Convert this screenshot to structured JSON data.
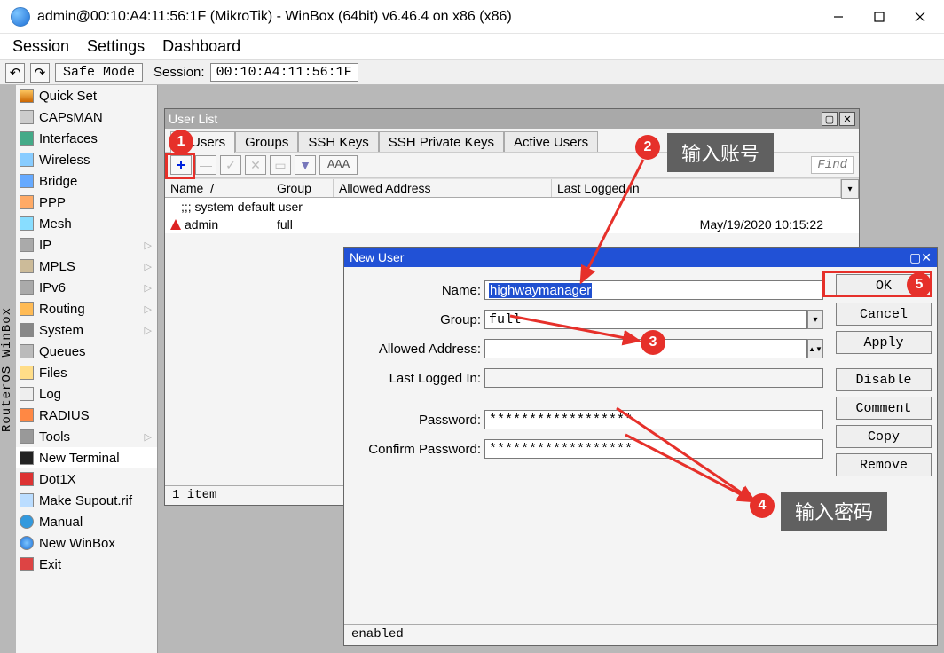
{
  "title": "admin@00:10:A4:11:56:1F (MikroTik) - WinBox (64bit) v6.46.4 on x86 (x86)",
  "menubar": {
    "items": [
      "Session",
      "Settings",
      "Dashboard"
    ]
  },
  "sessionbar": {
    "safe_mode": "Safe Mode",
    "session_label": "Session:",
    "session_value": "00:10:A4:11:56:1F"
  },
  "left_tab": "RouterOS WinBox",
  "side_menu": [
    {
      "label": "Quick Set",
      "icon": "quickset"
    },
    {
      "label": "CAPsMAN",
      "icon": "capsman"
    },
    {
      "label": "Interfaces",
      "icon": "interfaces"
    },
    {
      "label": "Wireless",
      "icon": "wireless"
    },
    {
      "label": "Bridge",
      "icon": "bridge"
    },
    {
      "label": "PPP",
      "icon": "ppp"
    },
    {
      "label": "Mesh",
      "icon": "mesh"
    },
    {
      "label": "IP",
      "icon": "ip",
      "sub": true
    },
    {
      "label": "MPLS",
      "icon": "mpls",
      "sub": true
    },
    {
      "label": "IPv6",
      "icon": "ipv6",
      "sub": true
    },
    {
      "label": "Routing",
      "icon": "routing",
      "sub": true
    },
    {
      "label": "System",
      "icon": "system",
      "sub": true
    },
    {
      "label": "Queues",
      "icon": "queues"
    },
    {
      "label": "Files",
      "icon": "files"
    },
    {
      "label": "Log",
      "icon": "log"
    },
    {
      "label": "RADIUS",
      "icon": "radius"
    },
    {
      "label": "Tools",
      "icon": "tools",
      "sub": true
    },
    {
      "label": "New Terminal",
      "icon": "terminal"
    },
    {
      "label": "Dot1X",
      "icon": "dot1x"
    },
    {
      "label": "Make Supout.rif",
      "icon": "supout"
    },
    {
      "label": "Manual",
      "icon": "manual"
    },
    {
      "label": "New WinBox",
      "icon": "winbox"
    },
    {
      "label": "Exit",
      "icon": "exit"
    }
  ],
  "user_list": {
    "title": "User List",
    "tabs": [
      "Users",
      "Groups",
      "SSH Keys",
      "SSH Private Keys",
      "Active Users"
    ],
    "aaa": "AAA",
    "find": "Find",
    "columns": [
      "Name",
      "Group",
      "Allowed Address",
      "Last Logged In"
    ],
    "group_row": ";;; system default user",
    "rows": [
      {
        "name": "admin",
        "group": "full",
        "allowed": "",
        "last": "May/19/2020 10:15:22"
      }
    ],
    "status": "1 item"
  },
  "new_user": {
    "title": "New User",
    "labels": {
      "name": "Name:",
      "group": "Group:",
      "allowed": "Allowed Address:",
      "last": "Last Logged In:",
      "password": "Password:",
      "confirm": "Confirm Password:"
    },
    "values": {
      "name": "highwaymanager",
      "group": "full",
      "allowed": "",
      "last": "",
      "password": "******************",
      "confirm": "******************"
    },
    "buttons": [
      "OK",
      "Cancel",
      "Apply",
      "Disable",
      "Comment",
      "Copy",
      "Remove"
    ],
    "status": "enabled"
  },
  "annotations": {
    "callout_name": "输入账号",
    "callout_password": "输入密码",
    "badges": {
      "1": "1",
      "2": "2",
      "3": "3",
      "4": "4",
      "5": "5"
    }
  }
}
